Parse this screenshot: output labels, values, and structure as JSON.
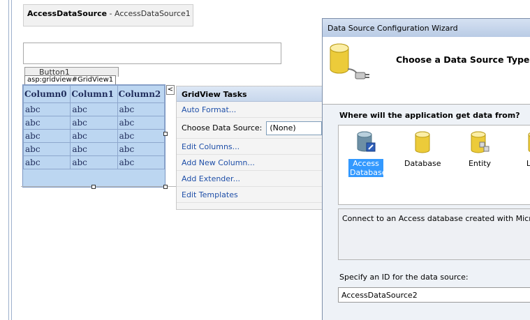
{
  "designer": {
    "datasource_box": {
      "control_type": "AccessDataSource",
      "separator": " - ",
      "control_id": "AccessDataSource1"
    },
    "hidden_button_text": "Button1",
    "gridview_tag": "asp:gridview#GridView1",
    "grid": {
      "columns": [
        "Column0",
        "Column1",
        "Column2"
      ],
      "rows": [
        [
          "abc",
          "abc",
          "abc"
        ],
        [
          "abc",
          "abc",
          "abc"
        ],
        [
          "abc",
          "abc",
          "abc"
        ],
        [
          "abc",
          "abc",
          "abc"
        ],
        [
          "abc",
          "abc",
          "abc"
        ]
      ]
    },
    "tasks_toggle": "<"
  },
  "tasks_panel": {
    "title": "GridView Tasks",
    "auto_format": "Auto Format...",
    "choose_ds_label": "Choose Data Source:",
    "choose_ds_value": "(None)",
    "edit_columns": "Edit Columns...",
    "add_column": "Add New Column...",
    "add_extender": "Add Extender...",
    "edit_templates": "Edit Templates"
  },
  "wizard": {
    "title": "Data Source Configuration Wizard",
    "heading": "Choose a Data Source Type",
    "question": "Where will the application get data from?",
    "types": [
      {
        "label": "Access Database",
        "icon": "access-database-icon",
        "selected": true
      },
      {
        "label": "Database",
        "icon": "database-icon",
        "selected": false
      },
      {
        "label": "Entity",
        "icon": "entity-icon",
        "selected": false
      },
      {
        "label": "LINQ",
        "icon": "linq-icon",
        "selected": false
      }
    ],
    "description": "Connect to an Access database created with Microsoft Access.",
    "id_label": "Specify an ID for the data source:",
    "id_value": "AccessDataSource2"
  },
  "colors": {
    "grid_bg": "#bcd6f1",
    "link": "#1f4fa8",
    "selection": "#3399ff"
  }
}
